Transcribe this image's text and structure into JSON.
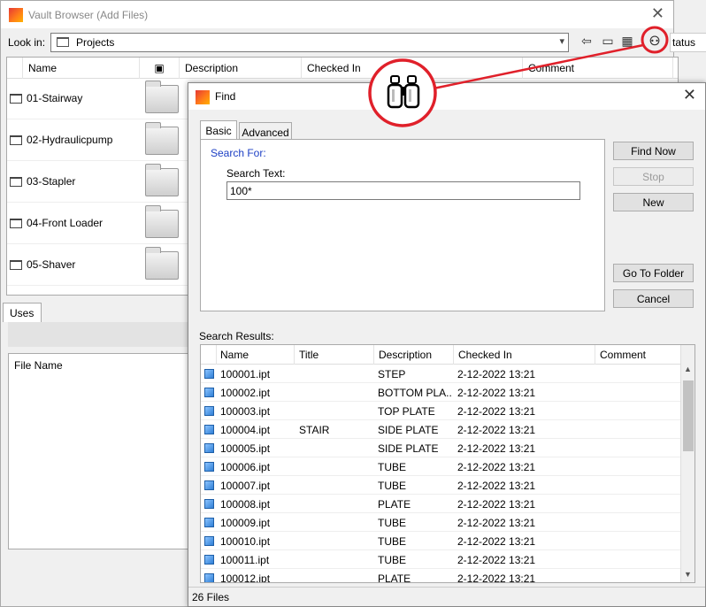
{
  "vault": {
    "title": "Vault Browser (Add Files)",
    "close_glyph": "✕",
    "look_in_label": "Look in:",
    "look_in_value": "Projects",
    "status_column_stub": "tatus",
    "columns": {
      "name": "Name",
      "description": "Description",
      "checked_in": "Checked In",
      "comment": "Comment"
    },
    "folders": [
      "01-Stairway",
      "02-Hydraulicpump",
      "03-Stapler",
      "04-Front Loader",
      "05-Shaver"
    ],
    "uses_tab": "Uses",
    "uses_column": "File Name"
  },
  "find": {
    "title": "Find",
    "close_glyph": "✕",
    "tabs": {
      "basic": "Basic",
      "advanced": "Advanced"
    },
    "search_for": "Search For:",
    "search_text_label": "Search Text:",
    "search_text_value": "100*",
    "buttons": {
      "find_now": "Find Now",
      "stop": "Stop",
      "new": "New",
      "go_to_folder": "Go To Folder",
      "cancel": "Cancel"
    },
    "results_label": "Search Results:",
    "result_columns": {
      "name": "Name",
      "title": "Title",
      "description": "Description",
      "checked_in": "Checked In",
      "comment": "Comment"
    },
    "results": [
      {
        "name": "100001.ipt",
        "title": "",
        "description": "STEP",
        "checked_in": "2-12-2022 13:21"
      },
      {
        "name": "100002.ipt",
        "title": "",
        "description": "BOTTOM PLA...",
        "checked_in": "2-12-2022 13:21"
      },
      {
        "name": "100003.ipt",
        "title": "",
        "description": "TOP PLATE",
        "checked_in": "2-12-2022 13:21"
      },
      {
        "name": "100004.ipt",
        "title": "STAIR",
        "description": "SIDE PLATE",
        "checked_in": "2-12-2022 13:21"
      },
      {
        "name": "100005.ipt",
        "title": "",
        "description": "SIDE PLATE",
        "checked_in": "2-12-2022 13:21"
      },
      {
        "name": "100006.ipt",
        "title": "",
        "description": "TUBE",
        "checked_in": "2-12-2022 13:21"
      },
      {
        "name": "100007.ipt",
        "title": "",
        "description": "TUBE",
        "checked_in": "2-12-2022 13:21"
      },
      {
        "name": "100008.ipt",
        "title": "",
        "description": "PLATE",
        "checked_in": "2-12-2022 13:21"
      },
      {
        "name": "100009.ipt",
        "title": "",
        "description": "TUBE",
        "checked_in": "2-12-2022 13:21"
      },
      {
        "name": "100010.ipt",
        "title": "",
        "description": "TUBE",
        "checked_in": "2-12-2022 13:21"
      },
      {
        "name": "100011.ipt",
        "title": "",
        "description": "TUBE",
        "checked_in": "2-12-2022 13:21"
      },
      {
        "name": "100012.ipt",
        "title": "",
        "description": "PLATE",
        "checked_in": "2-12-2022 13:21"
      }
    ],
    "status_count": "26 Files"
  },
  "icons": {
    "binoculars": "binoculars-icon",
    "back": "back-arrow-icon",
    "up_folder": "up-folder-icon",
    "view": "view-options-icon"
  },
  "colors": {
    "callout": "#e0202a",
    "search_for": "#1c3fc4"
  }
}
